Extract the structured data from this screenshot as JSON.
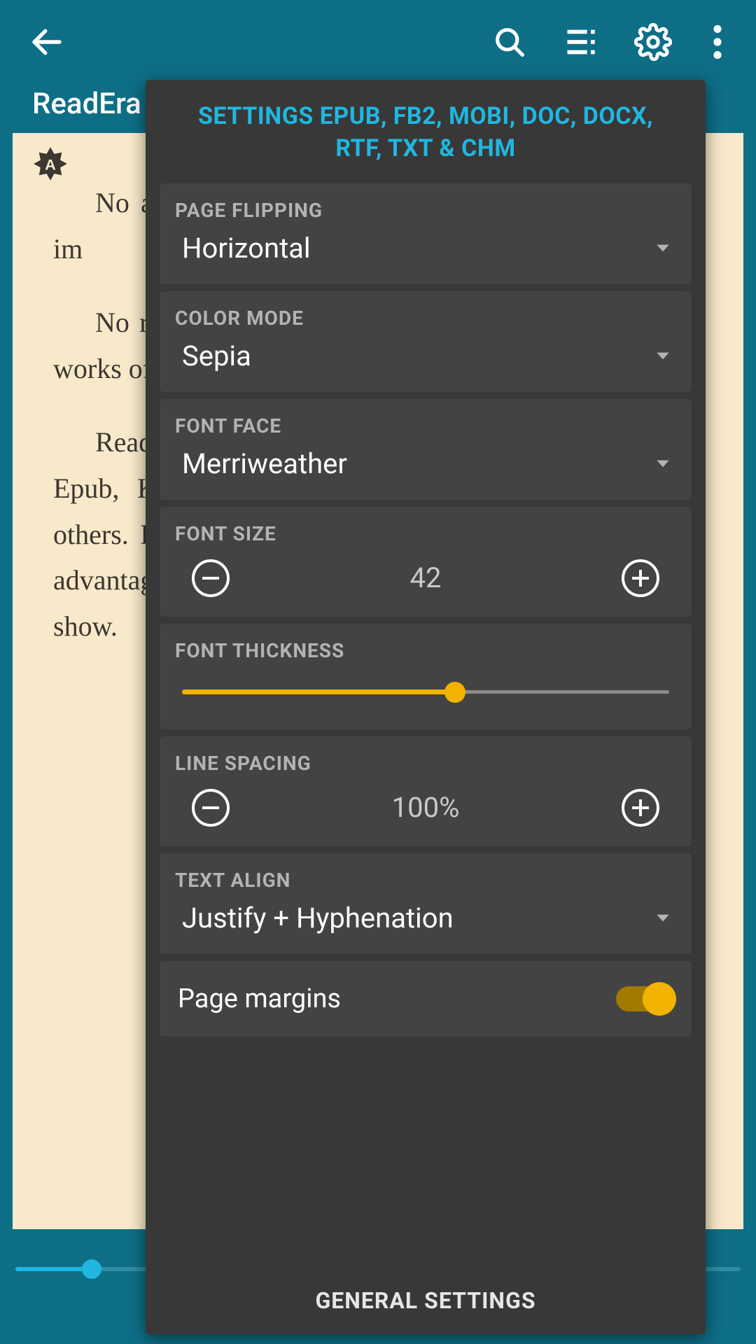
{
  "appbar": {
    "title": "ReadEra -"
  },
  "reader": {
    "paragraphs": [
      "No ads. The ReadEra program for viewing. ads nor im",
      "No register. The reader app does use any account. It works offline with books for free.",
      "Read books on a set of readers. It ads well, formats: Epub, Kindle, business PDF, Office (DOC, DOCX), others. Read any Word document, archives. It gives all advantages of PDF reader and files in portable mode will show."
    ]
  },
  "settings": {
    "title": "SETTINGS EPUB, FB2, MOBI, DOC, DOCX, RTF, TXT & CHM",
    "page_flipping": {
      "label": "PAGE FLIPPING",
      "value": "Horizontal"
    },
    "color_mode": {
      "label": "COLOR MODE",
      "value": "Sepia"
    },
    "font_face": {
      "label": "FONT FACE",
      "value": "Merriweather"
    },
    "font_size": {
      "label": "FONT SIZE",
      "value": "42"
    },
    "font_thickness": {
      "label": "FONT THICKNESS",
      "percent": 56
    },
    "line_spacing": {
      "label": "LINE SPACING",
      "value": "100%"
    },
    "text_align": {
      "label": "TEXT ALIGN",
      "value": "Justify + Hyphenation"
    },
    "page_margins": {
      "label": "Page margins",
      "on": true
    },
    "footer": "GENERAL SETTINGS"
  },
  "progress": {
    "percent": 10.5
  }
}
